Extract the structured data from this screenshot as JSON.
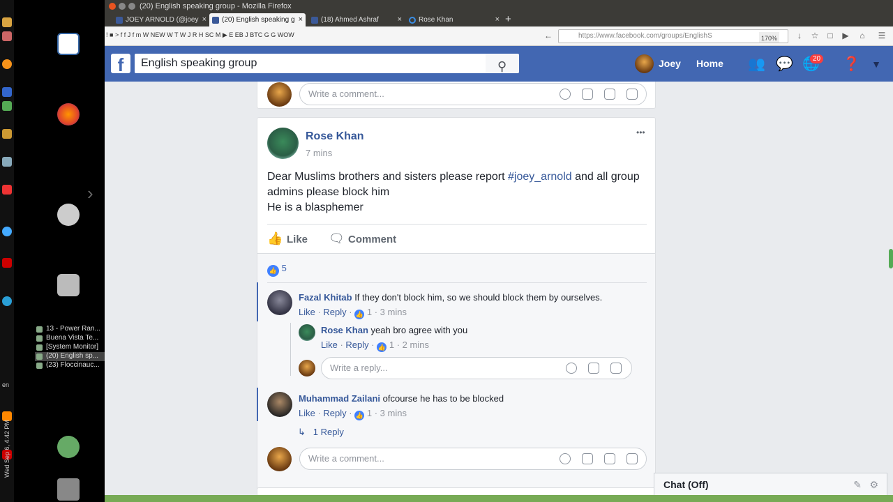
{
  "os": {
    "task_windows": [
      "13 - Power Ran...",
      "Buena Vista Te...",
      "[System Monitor]",
      "(20) English sp...",
      "(23) Floccinauc..."
    ],
    "clock": "Wed Sep 6, 4:42 PM",
    "language": "en"
  },
  "browser": {
    "title": "(20) English speaking group - Mozilla Firefox",
    "tabs": [
      {
        "label": "JOEY ARNOLD (@joey"
      },
      {
        "label": "(20) English speaking g"
      },
      {
        "label": "(18) Ahmed Ashraf"
      },
      {
        "label": "Rose Khan"
      }
    ],
    "new_tab": "+",
    "bookmarks": "! ■ > f f J f m W NEW W T W J R H SC M ▶ E EB J BTC G G WOW",
    "url": "https://www.facebook.com/groups/EnglishS",
    "zoom": "170%"
  },
  "facebook": {
    "logo": "f",
    "search_value": "English speaking group",
    "user_name": "Joey",
    "home_label": "Home",
    "notif_count": "20",
    "prev_comment_placeholder": "Write a comment...",
    "post": {
      "author": "Rose Khan",
      "time": "7 mins",
      "more": "•••",
      "text_before": "Dear Muslims brothers and sisters please report ",
      "hashtag": "#joey_arnold",
      "text_after": " and all group admins please block him",
      "line2": "He is a blasphemer",
      "like_label": "Like",
      "comment_label": "Comment",
      "reactions_count": "5"
    },
    "comments": [
      {
        "author": "Fazal Khitab",
        "text": " If they don't block him, so we should block them by ourselves.",
        "like": "Like",
        "reply": "Reply",
        "likes": "1",
        "time": "3 mins"
      },
      {
        "author": "Rose Khan",
        "text": " yeah bro agree with you",
        "like": "Like",
        "reply": "Reply",
        "likes": "1",
        "time": "2 mins"
      },
      {
        "author": "Muhammad Zailani",
        "text": " ofcourse he has to be blocked",
        "like": "Like",
        "reply": "Reply",
        "likes": "1",
        "time": "3 mins"
      }
    ],
    "reply_placeholder": "Write a reply...",
    "replies_link": "1 Reply",
    "comment_placeholder": "Write a comment...",
    "chat": "Chat (Off)"
  }
}
